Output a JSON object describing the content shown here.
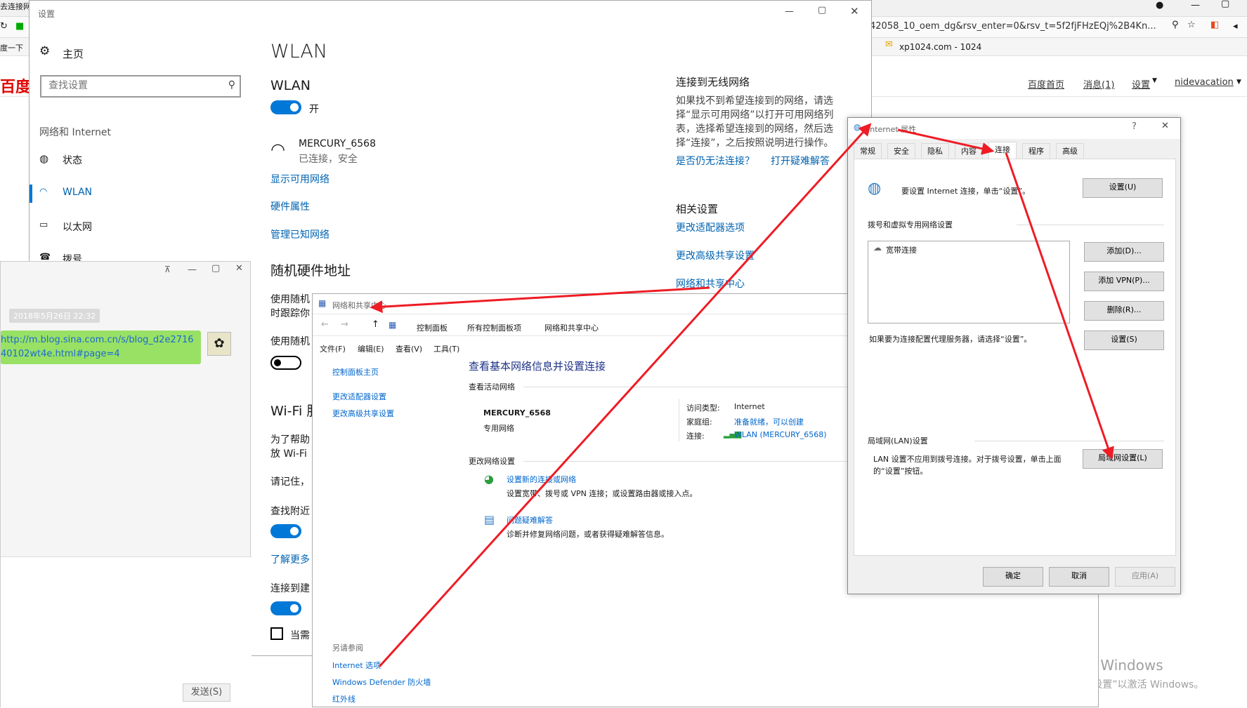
{
  "browser": {
    "tab_title": "去连接网",
    "url_text": "42058_10_oem_dg&rsv_enter=0&rsv_t=5f2fjFHzEQj%2B4Kn...",
    "bookmark_left": "度一下",
    "bookmark_xp": "xp1024.com - 1024",
    "baidu_logo": "百度",
    "nav_home": "百度首页",
    "nav_messages": "消息(1)",
    "nav_settings": "设置",
    "nav_user": "nidevacation"
  },
  "settings": {
    "window_title": "设置",
    "home": "主页",
    "search_placeholder": "查找设置",
    "section": "网络和 Internet",
    "nav": [
      {
        "label": "状态"
      },
      {
        "label": "WLAN"
      },
      {
        "label": "以太网"
      },
      {
        "label": "拨号"
      }
    ],
    "page_title": "WLAN",
    "wlan_heading": "WLAN",
    "wlan_toggle": "开",
    "network_name": "MERCURY_6568",
    "network_status": "已连接，安全",
    "link_show": "显示可用网络",
    "link_hardware": "硬件属性",
    "link_manage": "管理已知网络",
    "random_heading": "随机硬件地址",
    "random_desc1": "使用随机",
    "random_desc2": "时跟踪你",
    "random_use": "使用随机",
    "wifi_heading": "Wi-Fi 服",
    "wifi_desc1": "为了帮助",
    "wifi_desc2": "放 Wi-Fi",
    "remember": "请记住，",
    "find_nearby": "查找附近",
    "learn_more": "了解更多",
    "connect_to": "连接到建",
    "when_needed": "当需",
    "right_heading": "连接到无线网络",
    "right_desc": "如果找不到希望连接到的网络，请选择“显示可用网络”以打开可用网络列表，选择希望连接到的网络，然后选择“连接”，之后按照说明进行操作。",
    "right_link1": "是否仍无法连接？",
    "right_link2": "打开疑难解答",
    "related_heading": "相关设置",
    "related1": "更改适配器选项",
    "related2": "更改高级共享设置",
    "related3": "网络和共享中心"
  },
  "chat": {
    "timestamp": "2018年5月26日 22:32",
    "message": "http://m.blog.sina.com.cn/s/blog_d2e271640102wt4e.html#page=4",
    "send_button": "发送(S)"
  },
  "nsc": {
    "window_title": "网络和共享中心",
    "breadcrumb": [
      "控制面板",
      "所有控制面板项",
      "网络和共享中心"
    ],
    "menu": [
      "文件(F)",
      "编辑(E)",
      "查看(V)",
      "工具(T)"
    ],
    "side_home": "控制面板主页",
    "side_adapter": "更改适配器设置",
    "side_sharing": "更改高级共享设置",
    "heading": "查看基本网络信息并设置连接",
    "active_heading": "查看活动网络",
    "net_name": "MERCURY_6568",
    "net_type": "专用网络",
    "access_label": "访问类型:",
    "access_value": "Internet",
    "homegroup_label": "家庭组:",
    "homegroup_value": "准备就绪，可以创建",
    "conn_label": "连接:",
    "conn_value": "WLAN (MERCURY_6568)",
    "change_heading": "更改网络设置",
    "task1_title": "设置新的连接或网络",
    "task1_desc": "设置宽带、拨号或 VPN 连接；或设置路由器或接入点。",
    "task2_title": "问题疑难解答",
    "task2_desc": "诊断并修复网络问题，或者获得疑难解答信息。",
    "see_also": "另请参阅",
    "see_also_links": [
      "Internet 选项",
      "Windows Defender 防火墙",
      "红外线"
    ]
  },
  "inet": {
    "window_title": "Internet 属性",
    "help": "?",
    "tabs": [
      "常规",
      "安全",
      "隐私",
      "内容",
      "连接",
      "程序",
      "高级"
    ],
    "setup_text": "要设置 Internet 连接，单击“设置”。",
    "setup_button": "设置(U)",
    "dialup_heading": "拨号和虚拟专用网络设置",
    "dialup_item": "宽带连接",
    "add_button": "添加(D)...",
    "add_vpn_button": "添加 VPN(P)...",
    "remove_button": "删除(R)...",
    "settings_button": "设置(S)",
    "proxy_text": "如果要为连接配置代理服务器，请选择“设置”。",
    "lan_heading": "局域网(LAN)设置",
    "lan_text": "LAN 设置不应用到拨号连接。对于拨号设置，单击上面的“设置”按钮。",
    "lan_button": "局域网设置(L)",
    "ok": "确定",
    "cancel": "取消",
    "apply": "应用(A)"
  },
  "watermark": {
    "line1": "激活 Windows",
    "line2": "转到“设置”以激活 Windows。"
  },
  "colors": {
    "accent": "#0078d7",
    "link": "#0066cc",
    "arrow": "#ee1c25",
    "chat_bubble": "#98e165"
  }
}
